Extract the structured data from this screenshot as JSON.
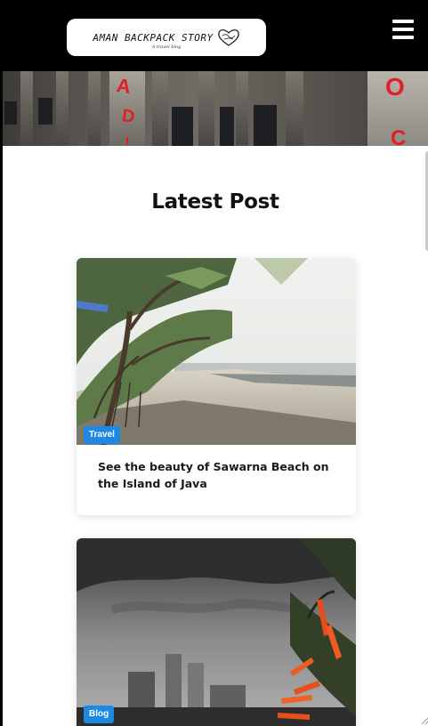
{
  "header": {
    "logo_text": "AMAN BACKPACK STORY",
    "logo_tagline": "A travel blog",
    "menu_icon": "hamburger-menu-icon"
  },
  "section": {
    "title": "Latest Post"
  },
  "posts": [
    {
      "category": "Travel",
      "title": "See the beauty of Sawarna Beach on the Island of Java"
    },
    {
      "category": "Blog",
      "title": ""
    }
  ],
  "colors": {
    "header_bg": "#000000",
    "badge_bg": "#1e88e5",
    "sign_red": "#e01f26"
  }
}
